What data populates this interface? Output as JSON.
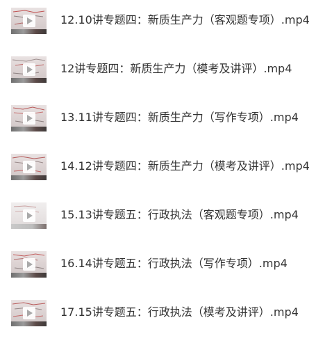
{
  "files": [
    {
      "name": "12.10讲专题四：新质生产力（客观题专项）.mp4",
      "thumbnail_icon": "video-thumbnail"
    },
    {
      "name": "12讲专题四：新质生产力（模考及讲评）.mp4",
      "thumbnail_icon": "video-thumbnail"
    },
    {
      "name": "13.11讲专题四：新质生产力（写作专项）.mp4",
      "thumbnail_icon": "video-thumbnail"
    },
    {
      "name": "14.12讲专题四：新质生产力（模考及讲评）.mp4",
      "thumbnail_icon": "video-thumbnail"
    },
    {
      "name": "15.13讲专题五：行政执法（客观题专项）.mp4",
      "thumbnail_icon": "video-thumbnail"
    },
    {
      "name": "16.14讲专题五：行政执法（写作专项）.mp4",
      "thumbnail_icon": "video-thumbnail"
    },
    {
      "name": "17.15讲专题五：行政执法（模考及讲评）.mp4",
      "thumbnail_icon": "video-thumbnail"
    }
  ],
  "colors": {
    "text": "#333333",
    "background": "#ffffff",
    "play_overlay": "#ffffff"
  }
}
